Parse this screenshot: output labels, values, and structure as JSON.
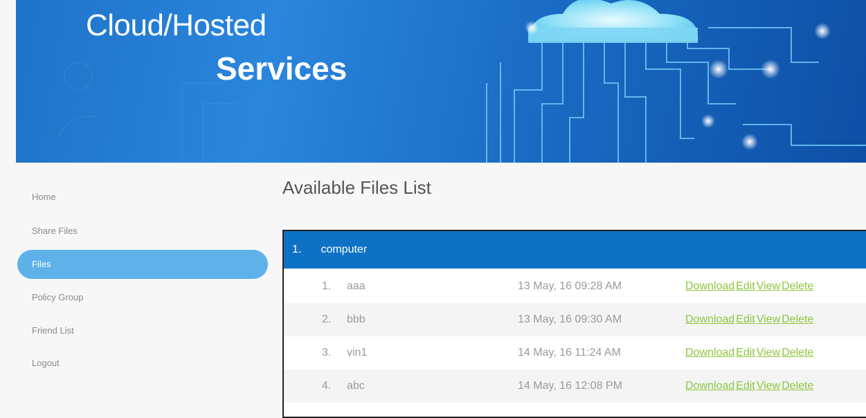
{
  "banner": {
    "title_line1": "Cloud/Hosted",
    "title_line2": "Services"
  },
  "sidebar": {
    "items": [
      {
        "label": "Home"
      },
      {
        "label": "Share Files"
      },
      {
        "label": "Files"
      },
      {
        "label": "Policy Group"
      },
      {
        "label": "Friend List"
      },
      {
        "label": "Logout"
      }
    ],
    "active_index": 2
  },
  "main": {
    "title": "Available Files List",
    "group": {
      "number": "1.",
      "name": "computer"
    },
    "files": [
      {
        "index": "1.",
        "name": "aaa",
        "date": "13 May, 16 09:28 AM"
      },
      {
        "index": "2.",
        "name": "bbb",
        "date": "13 May, 16 09:30 AM"
      },
      {
        "index": "3.",
        "name": "vin1",
        "date": "14 May, 16 11:24 AM"
      },
      {
        "index": "4.",
        "name": "abc",
        "date": "14 May, 16 12:08 PM"
      }
    ],
    "actions": {
      "download": "Download",
      "edit": "Edit",
      "view": "View",
      "delete": "Delete"
    }
  },
  "colors": {
    "header_blue": "#0e72c4",
    "active_nav": "#5fb1ea",
    "action_link": "#8cc63f"
  }
}
